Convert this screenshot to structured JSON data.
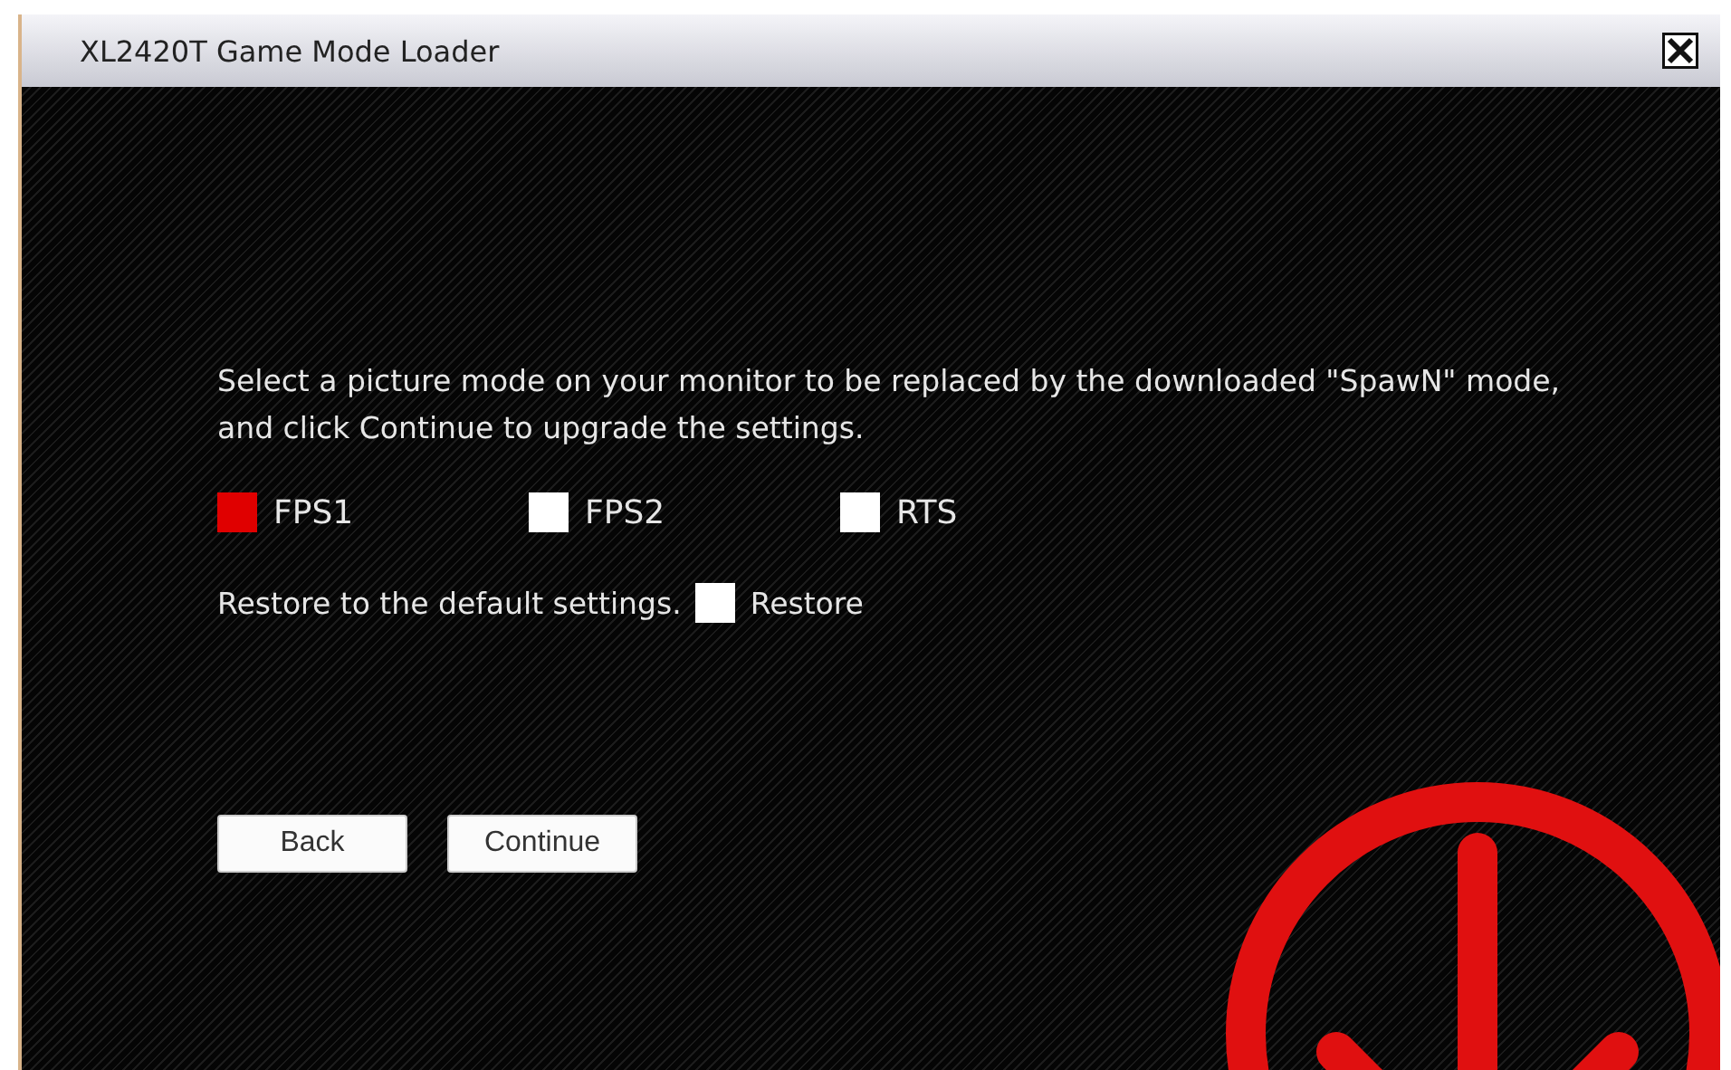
{
  "window": {
    "title": "XL2420T Game Mode Loader"
  },
  "instructions": "Select a picture mode on your monitor to be replaced by the downloaded \"SpawN\" mode, and click Continue to upgrade the settings.",
  "modes": [
    {
      "label": "FPS1",
      "selected": true
    },
    {
      "label": "FPS2",
      "selected": false
    },
    {
      "label": "RTS",
      "selected": false
    }
  ],
  "restore": {
    "text": "Restore to the default settings.",
    "label": "Restore",
    "checked": false
  },
  "buttons": [
    "Back",
    "Continue"
  ]
}
